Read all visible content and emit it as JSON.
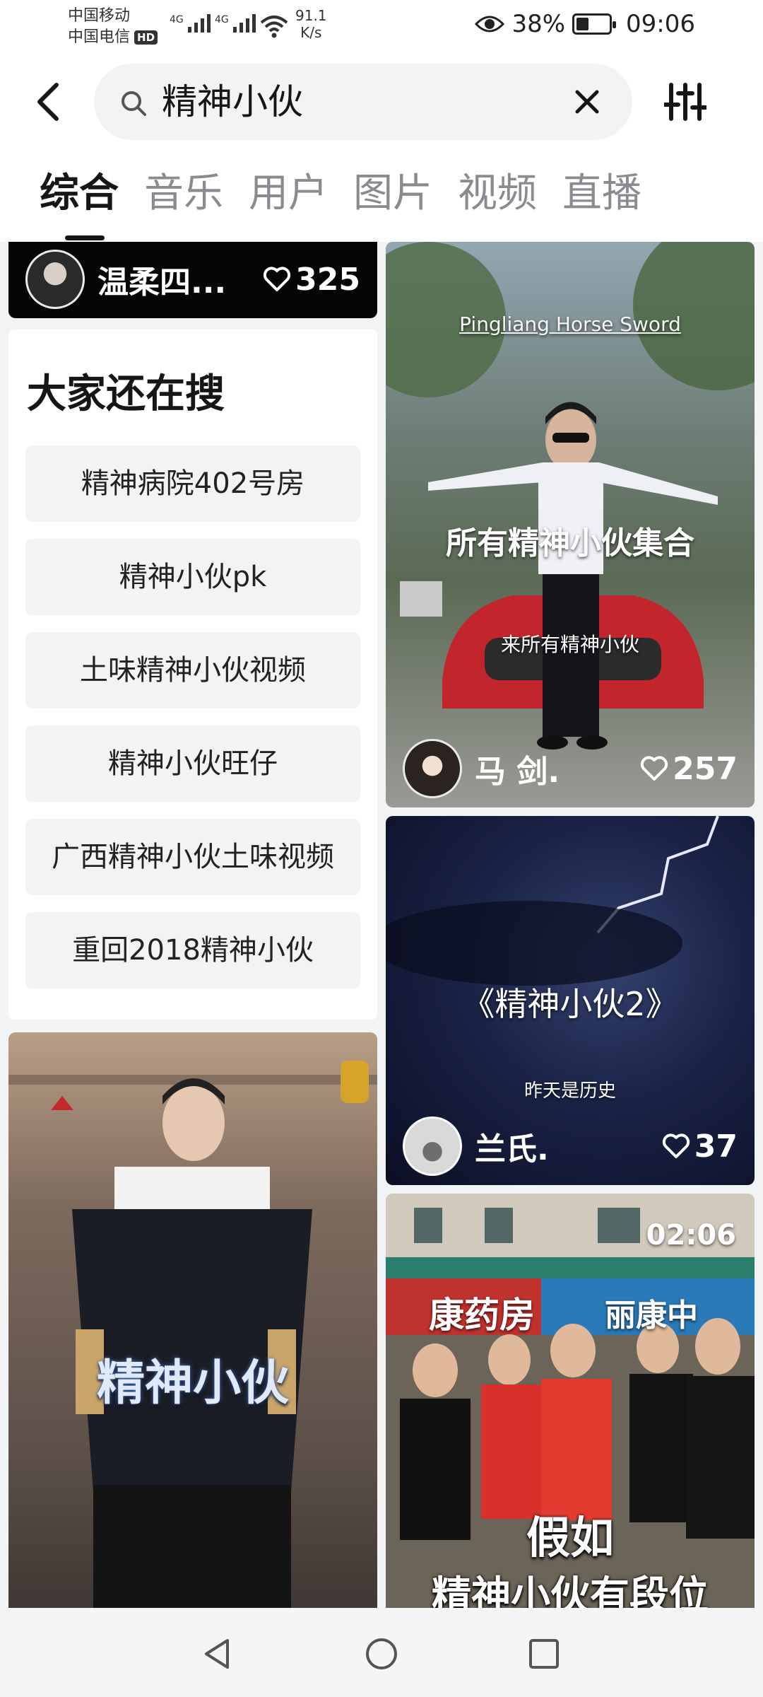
{
  "status_bar": {
    "carrier1": "中国移动",
    "carrier2": "中国电信",
    "hd_badge": "HD",
    "network1": "4G",
    "network2": "4G",
    "speed_value": "91.1",
    "speed_unit": "K/s",
    "battery": "38%",
    "battery_level": 0.38,
    "time": "09:06"
  },
  "search": {
    "query": "精神小伙"
  },
  "tabs": [
    {
      "label": "综合",
      "active": true
    },
    {
      "label": "音乐",
      "active": false
    },
    {
      "label": "用户",
      "active": false
    },
    {
      "label": "图片",
      "active": false
    },
    {
      "label": "视频",
      "active": false
    },
    {
      "label": "直播",
      "active": false
    }
  ],
  "feed": {
    "top_card": {
      "user": "温柔四...",
      "likes": "325"
    },
    "related": {
      "title": "大家还在搜",
      "items": [
        "精神病院402号房",
        "精神小伙pk",
        "土味精神小伙视频",
        "精神小伙旺仔",
        "广西精神小伙土味视频",
        "重回2018精神小伙"
      ]
    },
    "left_video": {
      "overlay": "精神小伙"
    },
    "card1": {
      "sign": "Pingliang Horse Sword",
      "overlay": "所有精神小伙集合",
      "subtitle": "来所有精神小伙",
      "user": "马 剑.",
      "likes": "257"
    },
    "card2": {
      "overlay": "《精神小伙2》",
      "subtitle": "昨天是历史",
      "user": "兰氏.",
      "likes": "37"
    },
    "card3": {
      "duration": "02:06",
      "shop_sign": "康药房",
      "shop_sign2": "丽康中",
      "overlay1": "假如",
      "overlay2": "精神小伙有段位"
    }
  },
  "colors": {
    "background": "#ffffff",
    "feed_background": "#f2f3f5",
    "search_background": "#f2f3f5",
    "active_tab": "#161616",
    "inactive_tab": "#8a8b91"
  }
}
